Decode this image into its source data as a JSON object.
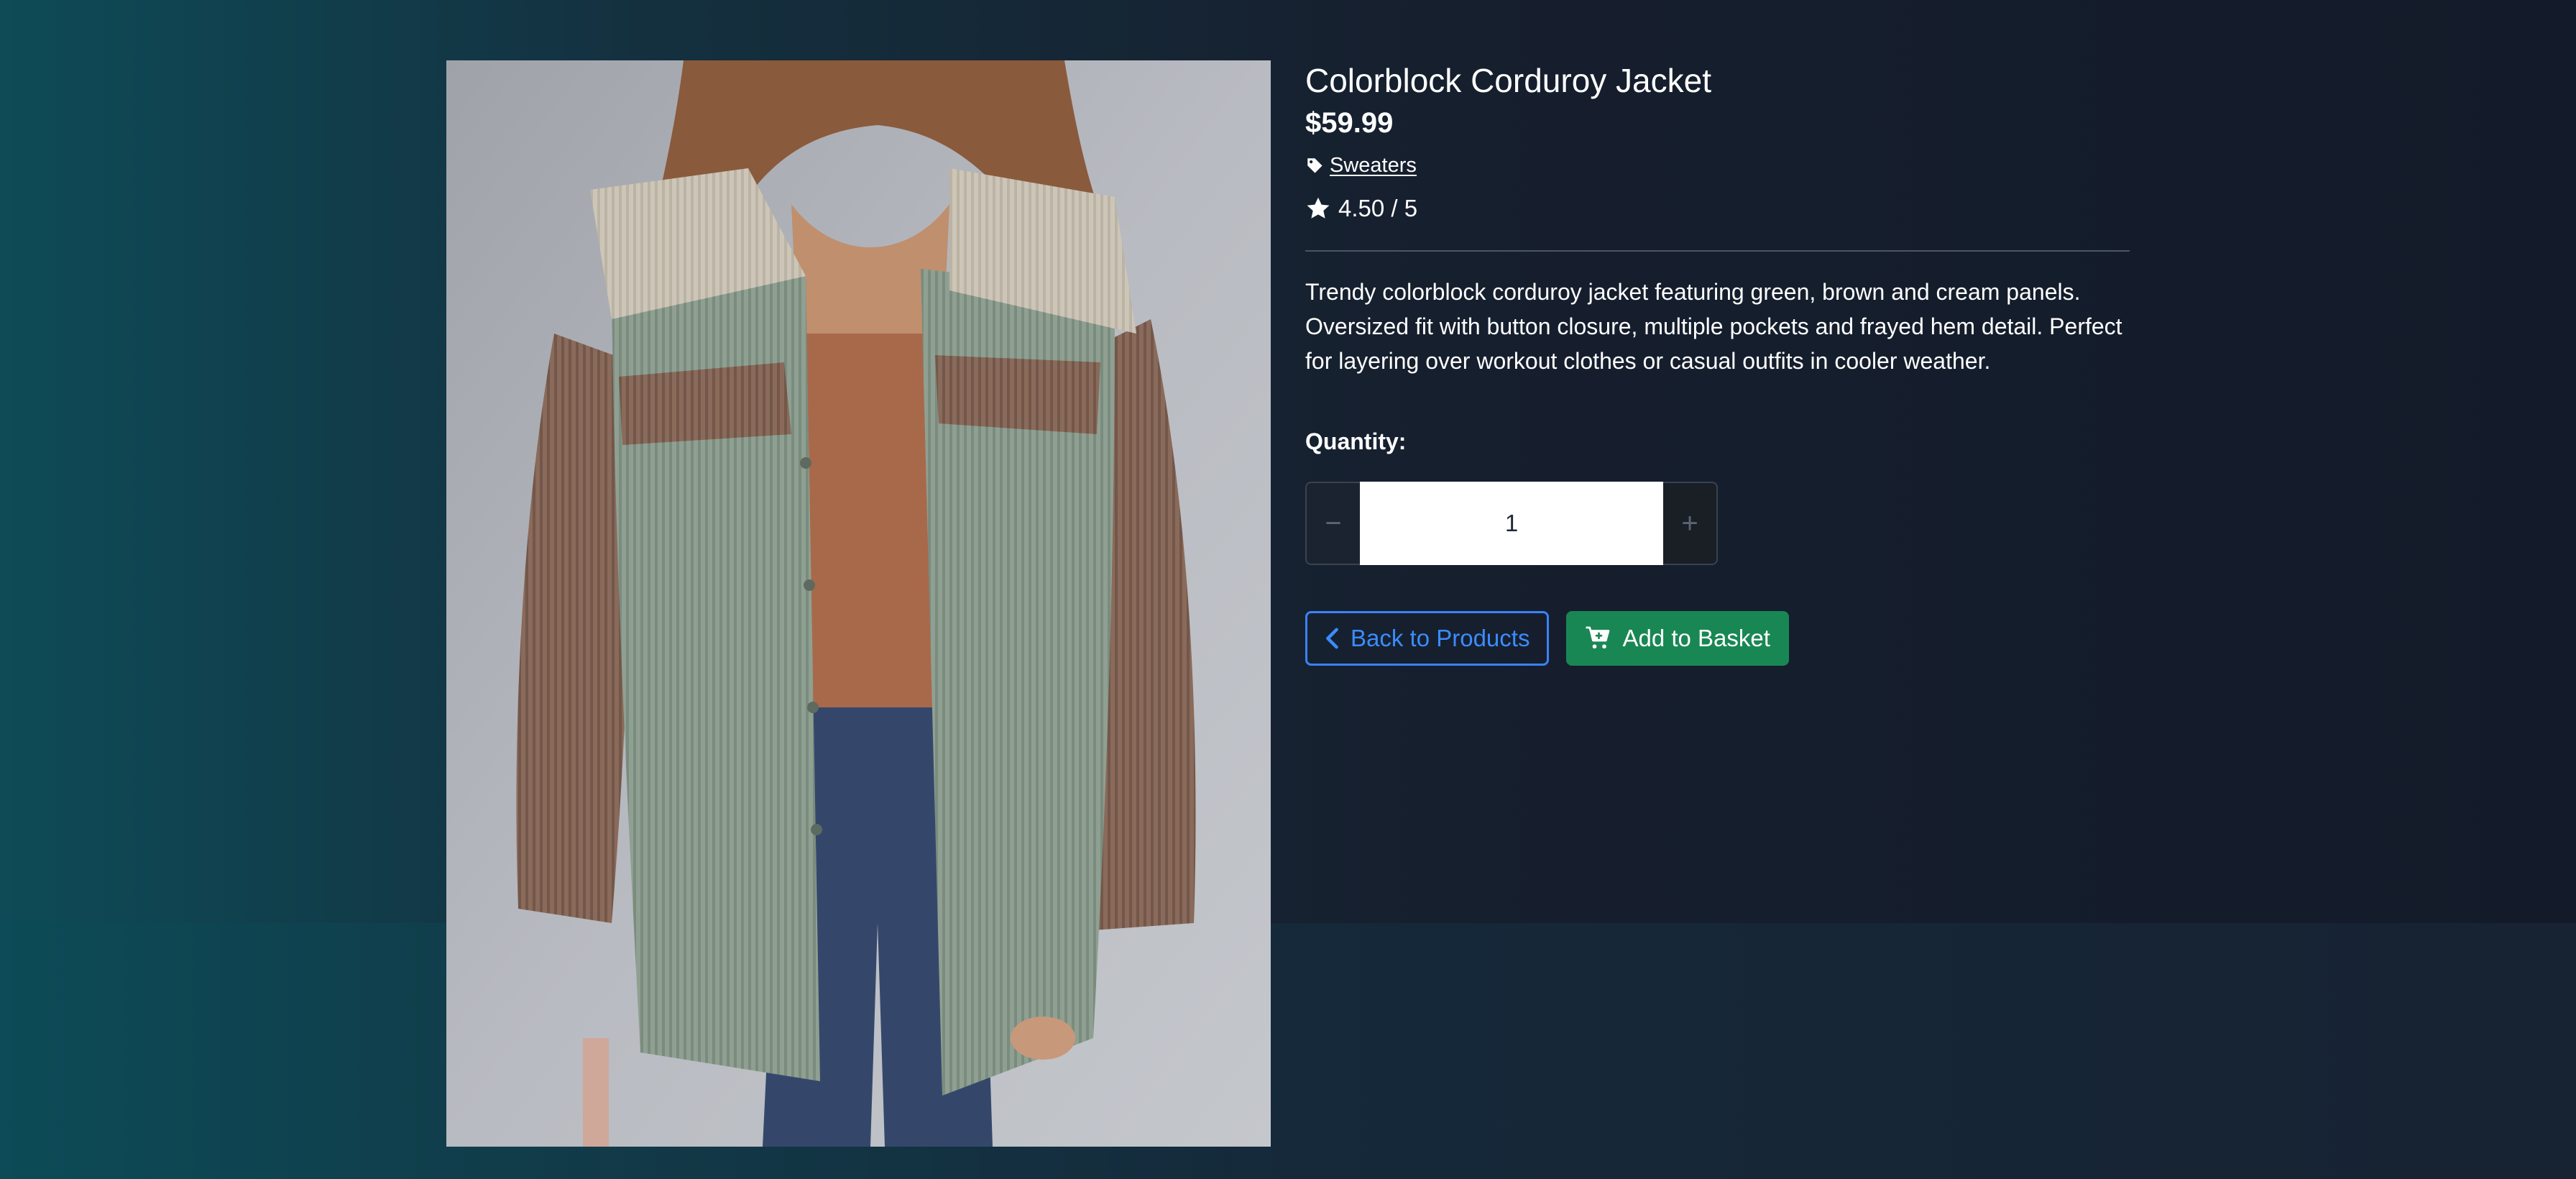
{
  "colors": {
    "background_left": "#0e4b57",
    "background_right": "#131b2a",
    "accent_blue": "#3b82f6",
    "success_green": "#198754",
    "divider": "#4b5563"
  },
  "product": {
    "title": "Colorblock Corduroy Jacket",
    "price": "$59.99",
    "category": {
      "icon": "tag-icon",
      "label": "Sweaters"
    },
    "rating": {
      "icon": "star-icon",
      "text": "4.50 / 5",
      "value": 4.5,
      "max": 5
    },
    "description": "Trendy colorblock corduroy jacket featuring green, brown and cream panels. Oversized fit with button closure, multiple pockets and frayed hem detail. Perfect for layering over workout clothes or casual outfits in cooler weather.",
    "image_icon": "product-photo"
  },
  "quantity": {
    "label": "Quantity:",
    "value": "1",
    "decrement_symbol": "−",
    "increment_symbol": "+"
  },
  "actions": {
    "back": {
      "label": "Back to Products",
      "icon": "chevron-left-icon"
    },
    "add_to_basket": {
      "label": "Add to Basket",
      "icon": "cart-plus-icon"
    }
  }
}
